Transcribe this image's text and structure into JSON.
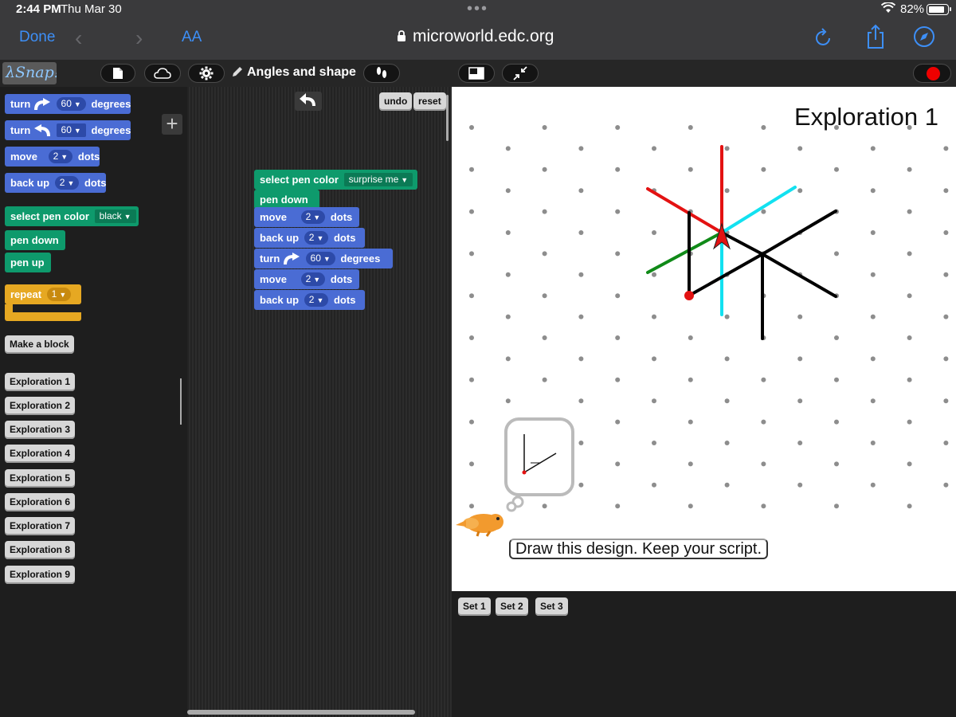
{
  "status": {
    "time": "2:44 PM",
    "date": "Thu Mar 30",
    "battery": "82%"
  },
  "browser": {
    "done": "Done",
    "text_size": "AA",
    "url": "microworld.edc.org"
  },
  "snap": {
    "logo": "λSnap!",
    "project_title": "Angles and shape",
    "undo": "undo",
    "reset": "reset"
  },
  "palette": {
    "turn_right": {
      "label": "turn",
      "value": "60",
      "unit": "degrees"
    },
    "turn_left": {
      "label": "turn",
      "value": "60",
      "unit": "degrees"
    },
    "move": {
      "label": "move",
      "value": "2",
      "unit": "dots"
    },
    "back_up": {
      "label": "back up",
      "value": "2",
      "unit": "dots"
    },
    "select_pen_color": {
      "label": "select pen color",
      "value": "black"
    },
    "pen_down": "pen down",
    "pen_up": "pen up",
    "repeat": {
      "label": "repeat",
      "value": "1"
    },
    "make_block": "Make a block",
    "explorations": [
      "Exploration 1",
      "Exploration 2",
      "Exploration 3",
      "Exploration 4",
      "Exploration 5",
      "Exploration 6",
      "Exploration 7",
      "Exploration 8",
      "Exploration 9"
    ]
  },
  "script": {
    "select_pen_color": {
      "label": "select pen color",
      "value": "surprise me"
    },
    "pen_down": "pen down",
    "move1": {
      "label": "move",
      "value": "2",
      "unit": "dots"
    },
    "back_up1": {
      "label": "back up",
      "value": "2",
      "unit": "dots"
    },
    "turn": {
      "label": "turn",
      "value": "60",
      "unit": "degrees"
    },
    "move2": {
      "label": "move",
      "value": "2",
      "unit": "dots"
    },
    "back_up2": {
      "label": "back up",
      "value": "2",
      "unit": "dots"
    }
  },
  "stage": {
    "title": "Exploration 1",
    "instruction": "Draw this design. Keep your script."
  },
  "sets": [
    "Set 1",
    "Set 2",
    "Set 3"
  ],
  "colors": {
    "motion": "#4a6cd4",
    "pen": "#0e9a6c",
    "control": "#e6a822",
    "line_red": "#e31212",
    "line_cyan": "#12e1f0",
    "line_green": "#108a18",
    "line_black": "#000000"
  }
}
